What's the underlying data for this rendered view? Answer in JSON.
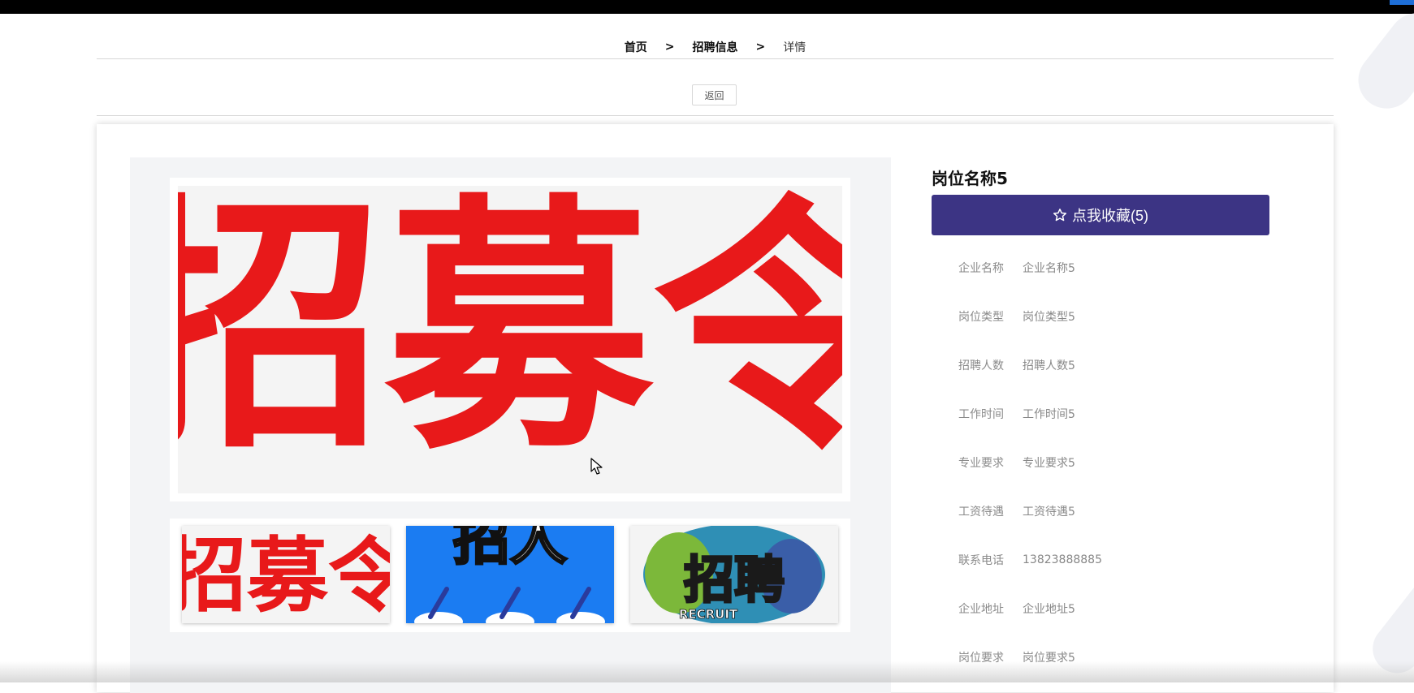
{
  "breadcrumb": {
    "home": "首页",
    "section": "招聘信息",
    "current": "详情",
    "separator": ">"
  },
  "back_label": "返回",
  "job": {
    "title": "岗位名称5",
    "favorite_label": "点我收藏(5)",
    "fields": [
      {
        "label": "企业名称",
        "value": "企业名称5"
      },
      {
        "label": "岗位类型",
        "value": "岗位类型5"
      },
      {
        "label": "招聘人数",
        "value": "招聘人数5"
      },
      {
        "label": "工作时间",
        "value": "工作时间5"
      },
      {
        "label": "专业要求",
        "value": "专业要求5"
      },
      {
        "label": "工资待遇",
        "value": "工资待遇5"
      },
      {
        "label": "联系电话",
        "value": "13823888885"
      },
      {
        "label": "企业地址",
        "value": "企业地址5"
      },
      {
        "label": "岗位要求",
        "value": "岗位要求5"
      }
    ]
  },
  "images": {
    "main_text": "招募令",
    "thumb1_text": "招募令",
    "thumb2_text": "招人",
    "thumb3_text": "招聘",
    "thumb3_sub": "RECRUIT"
  },
  "colors": {
    "favorite_button": "#3c3484",
    "thumb2_bg": "#1b7cf2",
    "recruit_red": "#e8191a"
  }
}
